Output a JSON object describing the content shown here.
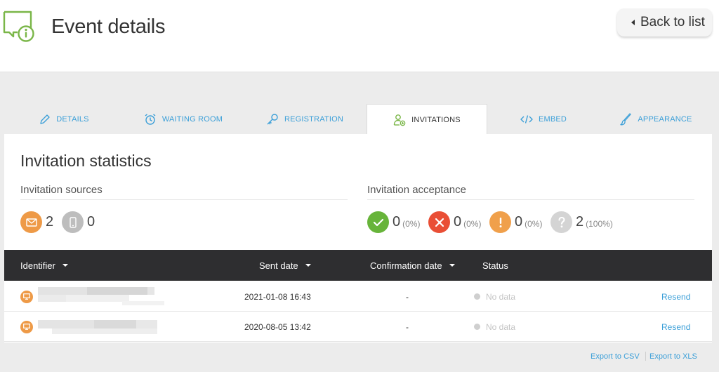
{
  "header": {
    "title": "Event details",
    "back_label": "Back to list",
    "icon": "chat-info-icon"
  },
  "tabs": [
    {
      "label": "DETAILS",
      "icon": "pencil-icon",
      "active": false
    },
    {
      "label": "WAITING ROOM",
      "icon": "alarm-clock-icon",
      "active": false
    },
    {
      "label": "REGISTRATION",
      "icon": "key-icon",
      "active": false
    },
    {
      "label": "INVITATIONS",
      "icon": "user-add-icon",
      "active": true
    },
    {
      "label": "EMBED",
      "icon": "code-icon",
      "active": false
    },
    {
      "label": "APPEARANCE",
      "icon": "brush-icon",
      "active": false
    }
  ],
  "stats": {
    "title": "Invitation statistics",
    "sources": {
      "title": "Invitation sources",
      "email_count": "2",
      "mobile_count": "0"
    },
    "acceptance": {
      "title": "Invitation acceptance",
      "accepted": {
        "count": "0",
        "pct": "(0%)"
      },
      "declined": {
        "count": "0",
        "pct": "(0%)"
      },
      "tentative": {
        "count": "0",
        "pct": "(0%)"
      },
      "unknown": {
        "count": "2",
        "pct": "(100%)"
      }
    }
  },
  "table": {
    "columns": {
      "identifier": "Identifier",
      "sent_date": "Sent date",
      "confirmation_date": "Confirmation date",
      "status": "Status"
    },
    "rows": [
      {
        "sent_date": "2021-01-08 16:43",
        "confirmation_date": "-",
        "status": "No data",
        "action": "Resend"
      },
      {
        "sent_date": "2020-08-05 13:42",
        "confirmation_date": "-",
        "status": "No data",
        "action": "Resend"
      }
    ]
  },
  "footer": {
    "export_csv": "Export to CSV",
    "export_xls": "Export to XLS"
  },
  "colors": {
    "accent": "#3b9fd8",
    "brand_green": "#7ab648",
    "email_orange": "#ee9a47",
    "accepted_green": "#67b43a",
    "declined_red": "#e94e35",
    "tentative_orange": "#f0a04b",
    "unknown_gray": "#d4d4d4",
    "table_header": "#2e2e30"
  }
}
